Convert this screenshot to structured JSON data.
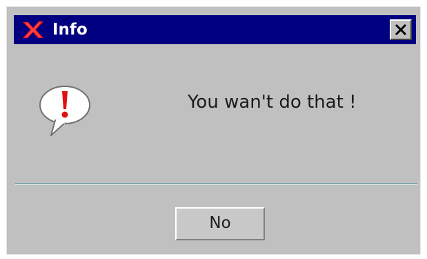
{
  "window": {
    "title": "Info",
    "app_icon": "red-x-icon",
    "close_icon": "close-icon"
  },
  "message": {
    "icon": "exclamation-speech-bubble-icon",
    "text": "You wan't do that !"
  },
  "buttons": {
    "no_label": "No"
  },
  "colors": {
    "title_bar": "#000080",
    "dialog_background": "#c0c0c0",
    "separator": "#7fa4a4",
    "exclamation": "#e01010"
  }
}
